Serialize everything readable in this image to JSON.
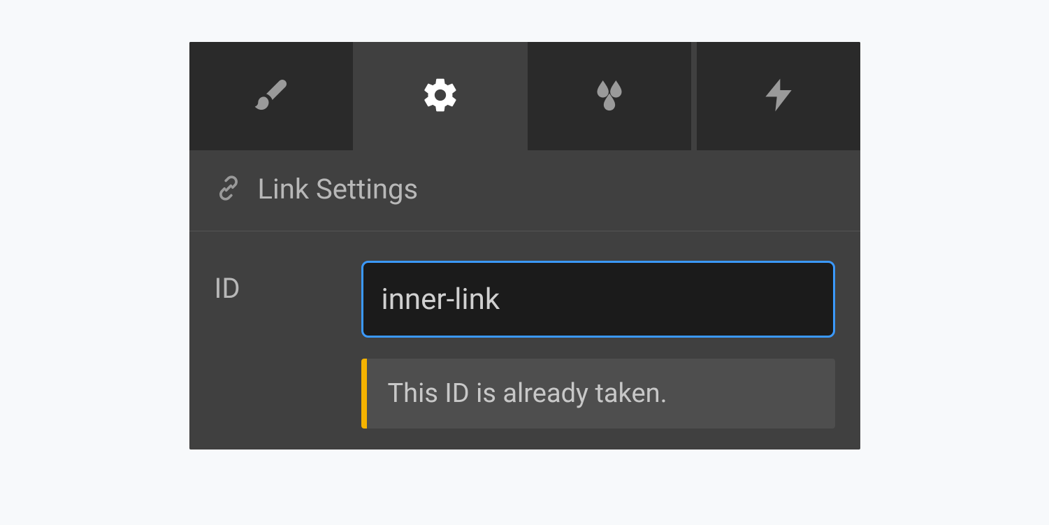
{
  "tabs": {
    "brush": {
      "icon": "brush-icon"
    },
    "settings": {
      "icon": "gear-icon"
    },
    "effects": {
      "icon": "droplets-icon"
    },
    "interactions": {
      "icon": "bolt-icon"
    }
  },
  "section": {
    "title": "Link Settings"
  },
  "field": {
    "id_label": "ID",
    "id_value": "inner-link",
    "warning": "This ID is already taken."
  }
}
